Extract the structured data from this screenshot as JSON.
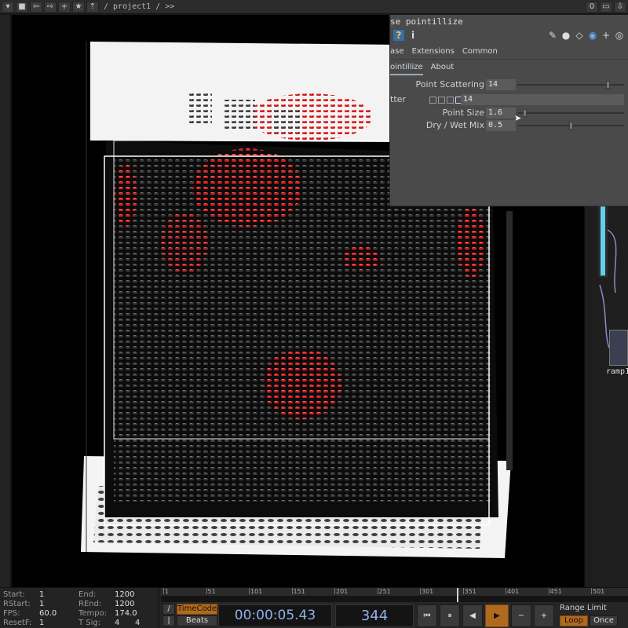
{
  "toolbar": {
    "path": "/ project1 / >>",
    "right_count": "0"
  },
  "dialog": {
    "title": "se pointillize",
    "tabs_top": [
      "ase",
      "Extensions",
      "Common"
    ],
    "tabs_page": [
      "ointillize",
      "About"
    ],
    "params": {
      "point_scattering": {
        "label": "Point Scattering",
        "value": "14",
        "level": 0.86
      },
      "scatter": {
        "label": "tter",
        "value": "14"
      },
      "point_size": {
        "label": "Point Size",
        "value": "1.6",
        "level": 0.05
      },
      "dry_wet": {
        "label": "Dry / Wet Mix",
        "value": "0.5",
        "level": 0.5
      }
    }
  },
  "node": {
    "label": "ramp1"
  },
  "stats": {
    "start": {
      "k": "Start:",
      "v": "1"
    },
    "rstart": {
      "k": "RStart:",
      "v": "1"
    },
    "fps": {
      "k": "FPS:",
      "v": "60.0"
    },
    "resetf": {
      "k": "ResetF:",
      "v": "1"
    },
    "end": {
      "k": "End:",
      "v": "1200"
    },
    "rend": {
      "k": "REnd:",
      "v": "1200"
    },
    "tempo": {
      "k": "Tempo:",
      "v": "174.0"
    },
    "tsig": {
      "k": "T Sig:",
      "v": "4",
      "v2": "4"
    }
  },
  "ruler": {
    "ticks": [
      "1",
      "51",
      "101",
      "151",
      "201",
      "251",
      "301",
      "351",
      "401",
      "451",
      "501"
    ]
  },
  "transport": {
    "timecode_label": "TimeCode",
    "beats_label": "Beats",
    "timecode": "00:00:05.43",
    "frame": "344",
    "range_label": "Range Limit",
    "loop_label": "Loop",
    "once_label": "Once"
  },
  "colors": {
    "accent": "#b06a1e",
    "readout": "#8fb1e8",
    "node_cyan": "#5fd0e8",
    "artwork_red": "#d41c1c"
  }
}
